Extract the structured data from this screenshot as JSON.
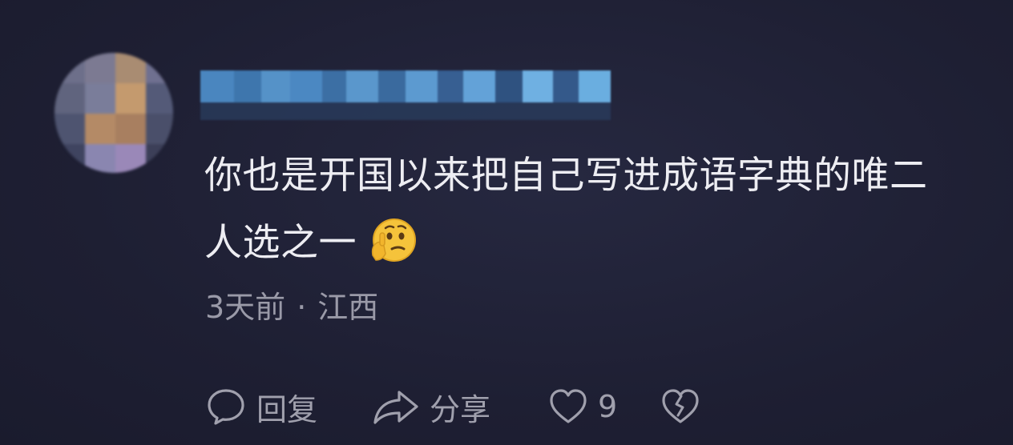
{
  "comment": {
    "line1": "你也是开国以来把自己写进成语字典的唯二",
    "line2": "人选之一",
    "emoji": "thinking-face-emoji"
  },
  "meta": {
    "time": "3天前",
    "separator": "·",
    "location": "江西"
  },
  "actions": {
    "reply_label": "回复",
    "share_label": "分享",
    "like_count": "9"
  },
  "colors": {
    "background": "#1f2034",
    "text": "#ededf2",
    "muted": "#9a9aa8",
    "username_blur": "#4a86c0",
    "emoji": "#f5c33b"
  },
  "icons": [
    "reply-bubble-icon",
    "share-arrow-icon",
    "heart-icon",
    "broken-heart-icon"
  ]
}
